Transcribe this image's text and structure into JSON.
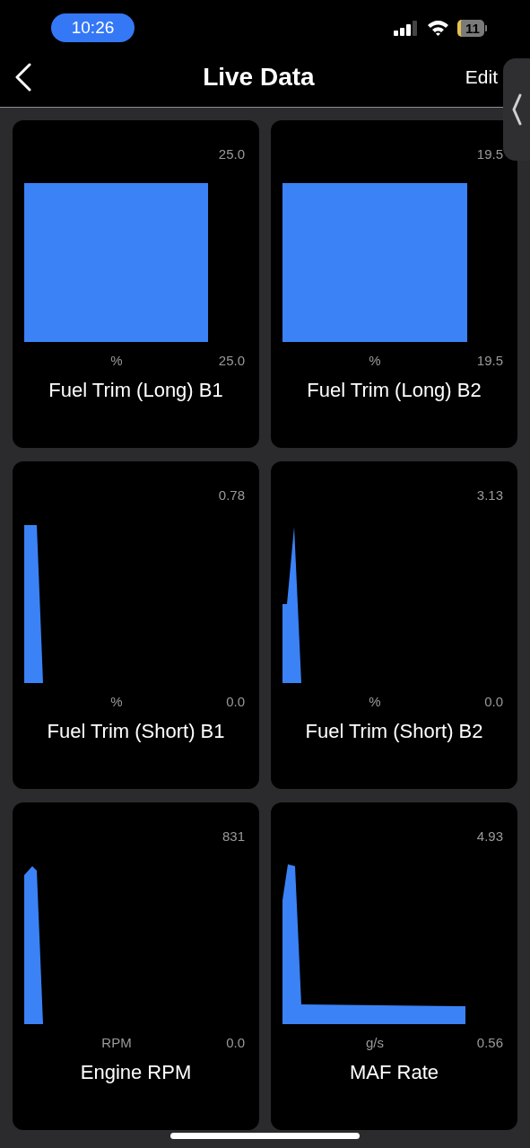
{
  "status_bar": {
    "time": "10:26",
    "battery": "11"
  },
  "header": {
    "title": "Live Data",
    "edit": "Edit"
  },
  "gauges": [
    {
      "name": "Fuel Trim (Long) B1",
      "unit": "%",
      "max": "25.0",
      "min": "25.0"
    },
    {
      "name": "Fuel Trim (Long) B2",
      "unit": "%",
      "max": "19.5",
      "min": "19.5"
    },
    {
      "name": "Fuel Trim (Short) B1",
      "unit": "%",
      "max": "0.78",
      "min": "0.0"
    },
    {
      "name": "Fuel Trim (Short) B2",
      "unit": "%",
      "max": "3.13",
      "min": "0.0"
    },
    {
      "name": "Engine RPM",
      "unit": "RPM",
      "max": "831",
      "min": "0.0"
    },
    {
      "name": "MAF Rate",
      "unit": "g/s",
      "max": "4.93",
      "min": "0.56"
    }
  ]
}
